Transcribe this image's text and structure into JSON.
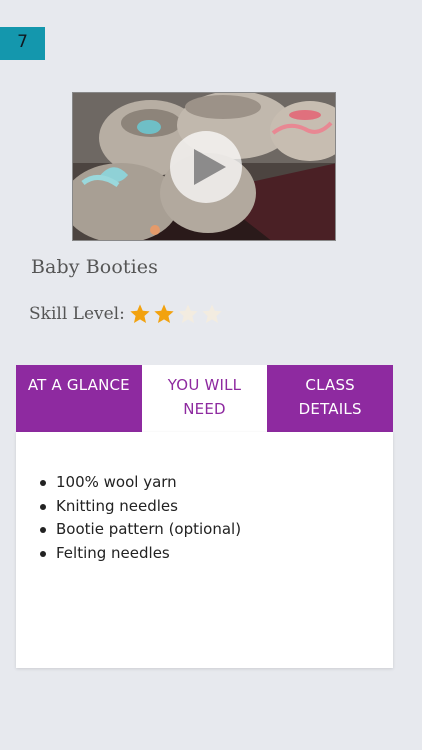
{
  "badge": {
    "number": "7",
    "color": "#1497ad"
  },
  "video": {
    "play_icon": "play-icon"
  },
  "class": {
    "title": "Baby Booties"
  },
  "skill": {
    "label": "Skill Level:",
    "rating": 2,
    "max": 5
  },
  "tabs": [
    {
      "label": "AT A GLANCE",
      "active": false
    },
    {
      "label": "YOU WILL NEED",
      "active": true
    },
    {
      "label": "CLASS DETAILS",
      "active": false
    }
  ],
  "need_list": [
    "100% wool yarn",
    "Knitting needles",
    "Bootie pattern (optional)",
    "Felting needles"
  ],
  "colors": {
    "accent": "#8e2aa0",
    "background": "#e7e9ee"
  }
}
